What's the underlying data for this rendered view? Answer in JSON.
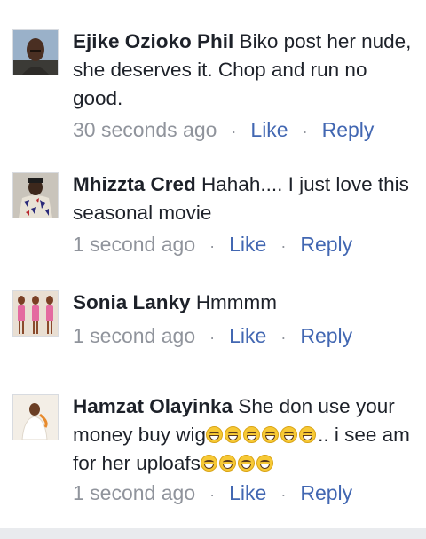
{
  "comments": [
    {
      "author": "Ejike Ozioko Phil",
      "text": "Biko post her nude, she deserves it. Chop and run no good.",
      "time": "30 seconds ago",
      "like": "Like",
      "reply": "Reply",
      "avatar": "man-portrait"
    },
    {
      "author": "Mhizzta Cred",
      "text": "Hahah.... I just love this seasonal movie",
      "time": "1 second ago",
      "like": "Like",
      "reply": "Reply",
      "avatar": "person-patterned-shirt"
    },
    {
      "author": "Sonia Lanky",
      "text": "Hmmmm",
      "time": "1 second ago",
      "like": "Like",
      "reply": "Reply",
      "avatar": "women-group"
    },
    {
      "author": "Hamzat Olayinka",
      "text_part1": "She don use your money buy wig",
      "text_part2": ".. i see am for her uploafs",
      "emoji_name": "grinning-squinting-face",
      "emoji_count_1": 6,
      "emoji_count_2": 4,
      "time": "1 second ago",
      "like": "Like",
      "reply": "Reply",
      "avatar": "person-white-outfit"
    }
  ],
  "separator": "·",
  "colors": {
    "link": "#4267b2",
    "meta": "#90949c",
    "text": "#1d2129"
  }
}
